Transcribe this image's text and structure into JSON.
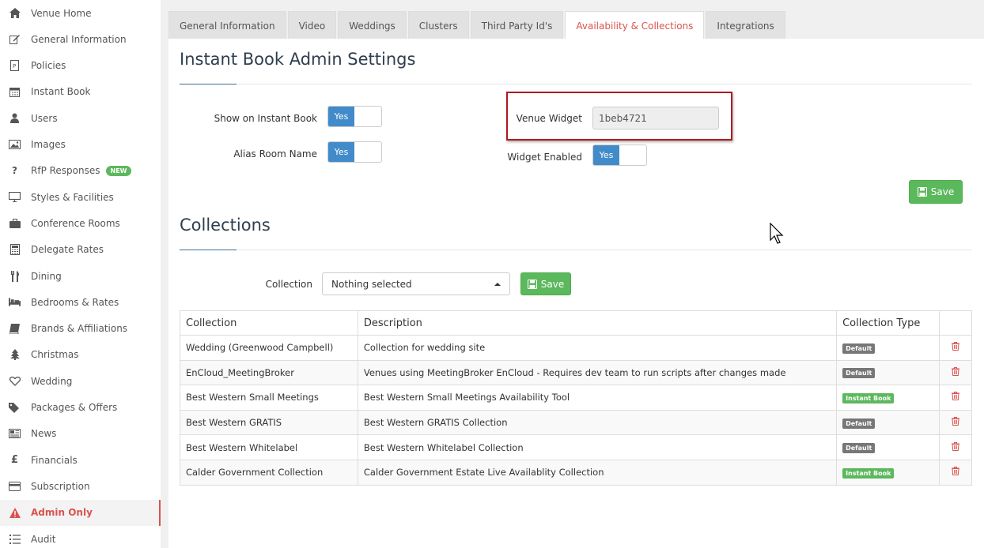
{
  "sidebar": {
    "items": [
      {
        "label": "Venue Home",
        "icon": "home-icon"
      },
      {
        "label": "General Information",
        "icon": "edit-icon"
      },
      {
        "label": "Policies",
        "icon": "policy-document-icon"
      },
      {
        "label": "Instant Book",
        "icon": "calendar-icon"
      },
      {
        "label": "Users",
        "icon": "user-icon"
      },
      {
        "label": "Images",
        "icon": "picture-icon"
      },
      {
        "label": "RfP Responses",
        "icon": "question-icon",
        "badge": "NEW"
      },
      {
        "label": "Styles & Facilities",
        "icon": "monitor-icon"
      },
      {
        "label": "Conference Rooms",
        "icon": "briefcase-icon"
      },
      {
        "label": "Delegate Rates",
        "icon": "calculator-icon"
      },
      {
        "label": "Dining",
        "icon": "cutlery-icon"
      },
      {
        "label": "Bedrooms & Rates",
        "icon": "bed-icon"
      },
      {
        "label": "Brands & Affiliations",
        "icon": "book-icon"
      },
      {
        "label": "Christmas",
        "icon": "tree-icon"
      },
      {
        "label": "Wedding",
        "icon": "heart-icon"
      },
      {
        "label": "Packages & Offers",
        "icon": "tags-icon"
      },
      {
        "label": "News",
        "icon": "newspaper-icon"
      },
      {
        "label": "Financials",
        "icon": "pound-icon"
      },
      {
        "label": "Subscription",
        "icon": "credit-card-icon"
      },
      {
        "label": "Admin Only",
        "icon": "warning-icon",
        "active": true
      },
      {
        "label": "Audit",
        "icon": "list-icon"
      }
    ]
  },
  "tabs": [
    {
      "label": "General Information"
    },
    {
      "label": "Video"
    },
    {
      "label": "Weddings"
    },
    {
      "label": "Clusters"
    },
    {
      "label": "Third Party Id's"
    },
    {
      "label": "Availability & Collections",
      "active": true
    },
    {
      "label": "Integrations"
    }
  ],
  "instant_book": {
    "title": "Instant Book Admin Settings",
    "show_on_instant_book_label": "Show on Instant Book",
    "show_on_instant_book_value": "Yes",
    "alias_room_name_label": "Alias Room Name",
    "alias_room_name_value": "Yes",
    "venue_widget_label": "Venue Widget",
    "venue_widget_value": "1beb4721",
    "widget_enabled_label": "Widget Enabled",
    "widget_enabled_value": "Yes",
    "save_label": "Save"
  },
  "collections": {
    "title": "Collections",
    "collection_label": "Collection",
    "select_value": "Nothing selected",
    "save_label": "Save",
    "columns": [
      "Collection",
      "Description",
      "Collection Type",
      ""
    ],
    "rows": [
      {
        "name": "Wedding (Greenwood Campbell)",
        "description": "Collection for wedding site",
        "type": "Default"
      },
      {
        "name": "EnCloud_MeetingBroker",
        "description": "Venues using MeetingBroker EnCloud - Requires dev team to run scripts after changes made",
        "type": "Default"
      },
      {
        "name": "Best Western Small Meetings",
        "description": "Best Western Small Meetings Availability Tool",
        "type": "Instant Book"
      },
      {
        "name": "Best Western GRATIS",
        "description": "Best Western GRATIS Collection",
        "type": "Default"
      },
      {
        "name": "Best Western Whitelabel",
        "description": "Best Western Whitelabel Collection",
        "type": "Default"
      },
      {
        "name": "Calder Government Collection",
        "description": "Calder Government Estate Live Availablity Collection",
        "type": "Instant Book"
      }
    ]
  },
  "colors": {
    "accent_red": "#d9534f",
    "primary_blue": "#428bca",
    "success_green": "#5cb85c",
    "highlight_box": "#b0191e"
  }
}
